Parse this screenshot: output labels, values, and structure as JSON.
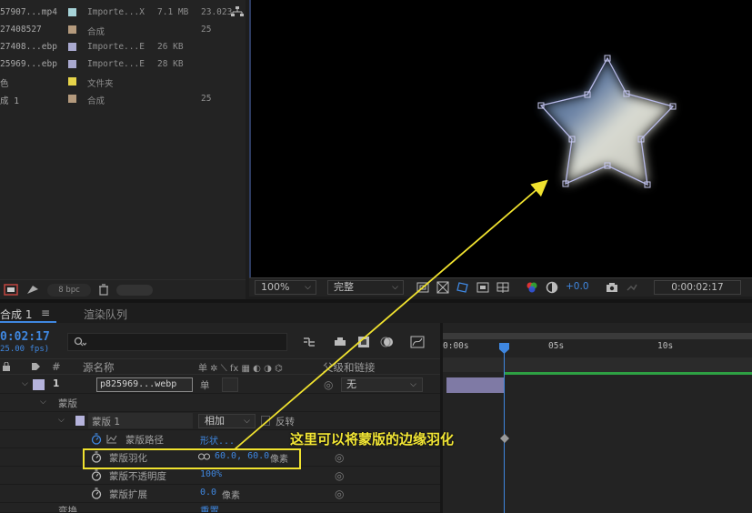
{
  "project": {
    "items": [
      {
        "name": "57907...mp4",
        "swatch": "#a6d3d8",
        "type": "Importe...X",
        "size": "7.1 MB",
        "duration": "23.023"
      },
      {
        "name": "27408527",
        "swatch": "#b49a7d",
        "type": "合成",
        "size": "",
        "duration": "25"
      },
      {
        "name": "27408...ebp",
        "swatch": "#a9a9cf",
        "type": "Importe...E",
        "size": "26 KB",
        "duration": ""
      },
      {
        "name": "25969...ebp",
        "swatch": "#a9a9cf",
        "type": "Importe...E",
        "size": "28 KB",
        "duration": ""
      },
      {
        "name": "色",
        "swatch": "#e6d44a",
        "type": "文件夹",
        "size": "",
        "duration": ""
      },
      {
        "name": "成 1",
        "swatch": "#b49a7d",
        "type": "合成",
        "size": "",
        "duration": "25"
      }
    ],
    "bpc": "8 bpc"
  },
  "viewer": {
    "zoom": "100%",
    "resolution": "完整",
    "exposure": "+0.0",
    "time": "0:00:02:17"
  },
  "tabs": {
    "comp": "合成 1",
    "menu": "≡",
    "render": "渲染队列"
  },
  "timeline": {
    "timecode": "0:02:17",
    "fps": "25.00 fps)",
    "columns": {
      "source_name": "源名称",
      "parent": "父级和链接",
      "number": "#"
    },
    "ruler": [
      "0:00s",
      "05s",
      "10s"
    ],
    "layer": {
      "number": "1",
      "name": "p825969...webp",
      "switch": "单",
      "parent": "无"
    },
    "mask_group": "蒙版",
    "mask": {
      "name": "蒙版 1",
      "mode": "相加",
      "inverted": "反转"
    },
    "props": [
      {
        "label": "蒙版路径",
        "value": "形状...",
        "extra": ""
      },
      {
        "label": "蒙版羽化",
        "value": "60.0, 60.0",
        "extra": "像素"
      },
      {
        "label": "蒙版不透明度",
        "value": "100%",
        "extra": ""
      },
      {
        "label": "蒙版扩展",
        "value": "0.0",
        "extra": "像素"
      }
    ],
    "next_group": "变换",
    "next_value": "重置"
  },
  "annotation": {
    "text": "这里可以将蒙版的边缘羽化",
    "color": "#f2e635"
  }
}
